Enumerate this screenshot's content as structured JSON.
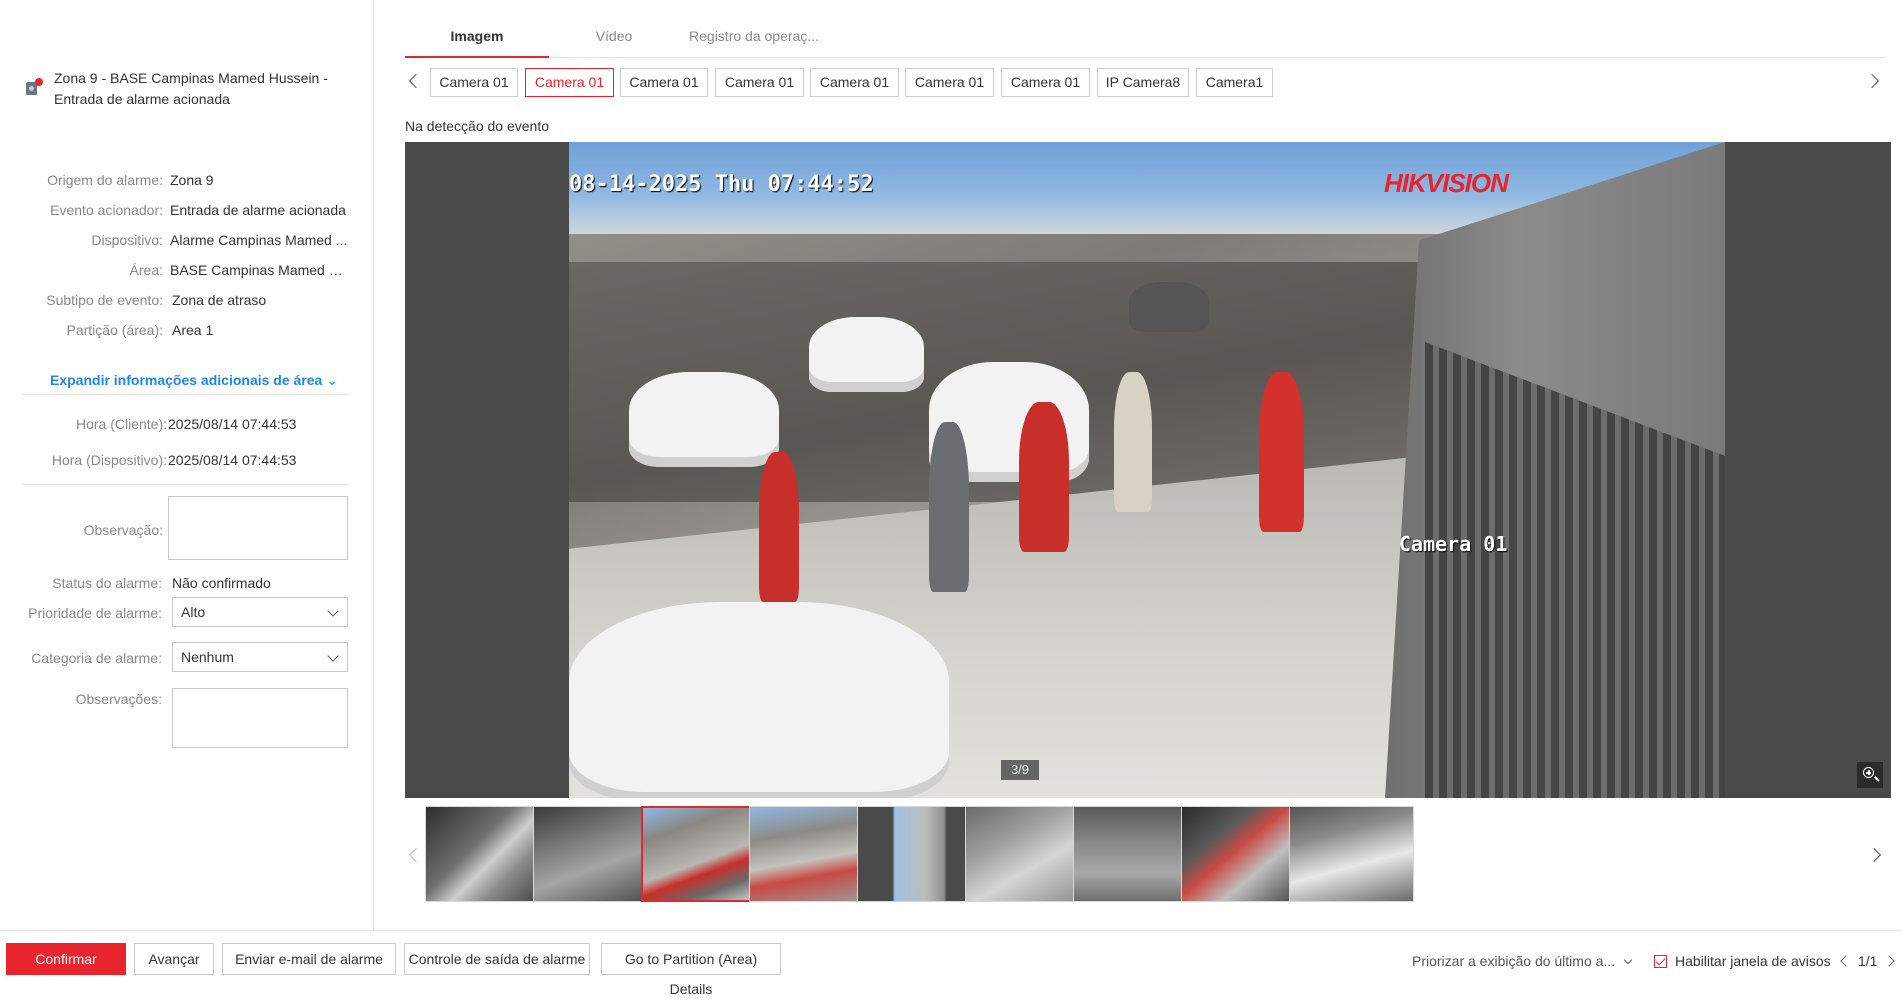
{
  "alarm": {
    "title": "Zona 9 - BASE Campinas Mamed Hussein - Entrada de alarme acionada",
    "icon": "alarm-device-icon"
  },
  "details": [
    {
      "label": "Origem do alarme:",
      "value": "Zona 9"
    },
    {
      "label": "Evento acionador:",
      "value": "Entrada de alarme acionada"
    },
    {
      "label": "Dispositivo:",
      "value": "Alarme Campinas Mamed ..."
    },
    {
      "label": "Área:",
      "value": "BASE Campinas Mamed H..."
    },
    {
      "label": "Subtipo de evento:",
      "value": "Zona de atraso"
    },
    {
      "label": "Partição (área):",
      "value": "Area 1"
    }
  ],
  "expand_label": "Expandir informações adicionais de área",
  "times": [
    {
      "label": "Hora (Cliente):",
      "value": "2025/08/14 07:44:53"
    },
    {
      "label": "Hora (Dispositivo):",
      "value": "2025/08/14 07:44:53"
    }
  ],
  "form": {
    "observacao_label": "Observação:",
    "observacao_value": "",
    "status_label": "Status do alarme:",
    "status_value": "Não confirmado",
    "priority_label": "Prioridade de alarme:",
    "priority_value": "Alto",
    "category_label": "Categoria de alarme:",
    "category_value": "Nenhum",
    "observacoes_label": "Observações:",
    "observacoes_value": ""
  },
  "tabs": [
    {
      "label": "Imagem",
      "active": true
    },
    {
      "label": "Vídeo",
      "active": false
    },
    {
      "label": "Registro da operaç...",
      "active": false
    }
  ],
  "cameras": [
    {
      "label": "Camera 01",
      "active": false
    },
    {
      "label": "Camera 01",
      "active": true
    },
    {
      "label": "Camera 01",
      "active": false
    },
    {
      "label": "Camera 01",
      "active": false
    },
    {
      "label": "Camera 01",
      "active": false
    },
    {
      "label": "Camera 01",
      "active": false
    },
    {
      "label": "Camera 01",
      "active": false
    },
    {
      "label": "IP Camera8",
      "active": false
    },
    {
      "label": "Camera1",
      "active": false
    }
  ],
  "detect_label": "Na detecção do evento",
  "viewer": {
    "osd_timestamp": "08-14-2025 Thu 07:44:52",
    "osd_camera": "Camera 01",
    "brand": "HIKVISION",
    "counter": "3/9"
  },
  "thumbnails": {
    "count": 9,
    "active_index": 2
  },
  "footer": {
    "confirm": "Confirmar",
    "next": "Avançar",
    "email": "Enviar e-mail de alarme",
    "output": "Controle de saída de alarme",
    "partition": "Go to Partition (Area) Details",
    "priority_select": "Priorizar a exibição do último a...",
    "enable_popup": "Habilitar janela de avisos",
    "page": "1/1"
  },
  "colors": {
    "accent": "#e8242c",
    "link": "#1e88e5"
  }
}
